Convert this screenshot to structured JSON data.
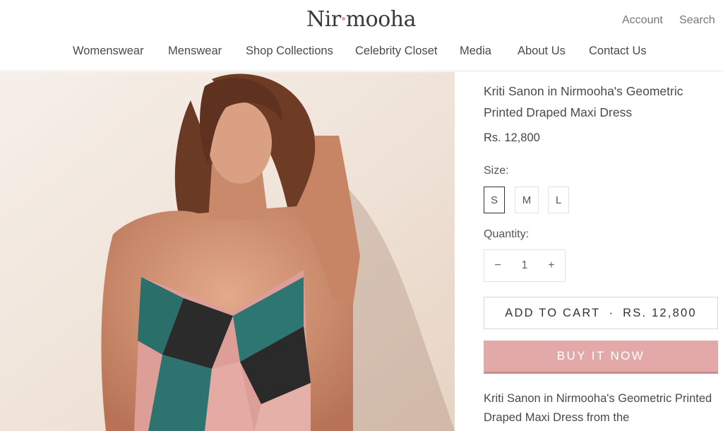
{
  "header": {
    "logo": {
      "part1": "Nir",
      "part2": "mooha"
    },
    "account_label": "Account",
    "search_label": "Search",
    "nav": [
      "Womenswear",
      "Menswear",
      "Shop Collections",
      "Celebrity Closet",
      "Media",
      "About Us",
      "Contact Us"
    ]
  },
  "product": {
    "image_icon": "product-photo",
    "title": "Kriti Sanon in Nirmooha's Geometric Printed Draped Maxi Dress",
    "price": "Rs. 12,800",
    "size_label": "Size:",
    "sizes": [
      "S",
      "M",
      "L"
    ],
    "selected_size": "S",
    "quantity_label": "Quantity:",
    "quantity_minus": "−",
    "quantity_value": "1",
    "quantity_plus": "+",
    "add_to_cart": {
      "label": "ADD TO CART",
      "separator": "·",
      "price": "RS. 12,800"
    },
    "buy_now": "BUY IT NOW",
    "description": "Kriti Sanon in Nirmooha's Geometric Printed Draped Maxi Dress from the"
  },
  "colors": {
    "accent": "#e3a9a9",
    "text": "#4a4a4a",
    "border": "#e2e2e2"
  }
}
